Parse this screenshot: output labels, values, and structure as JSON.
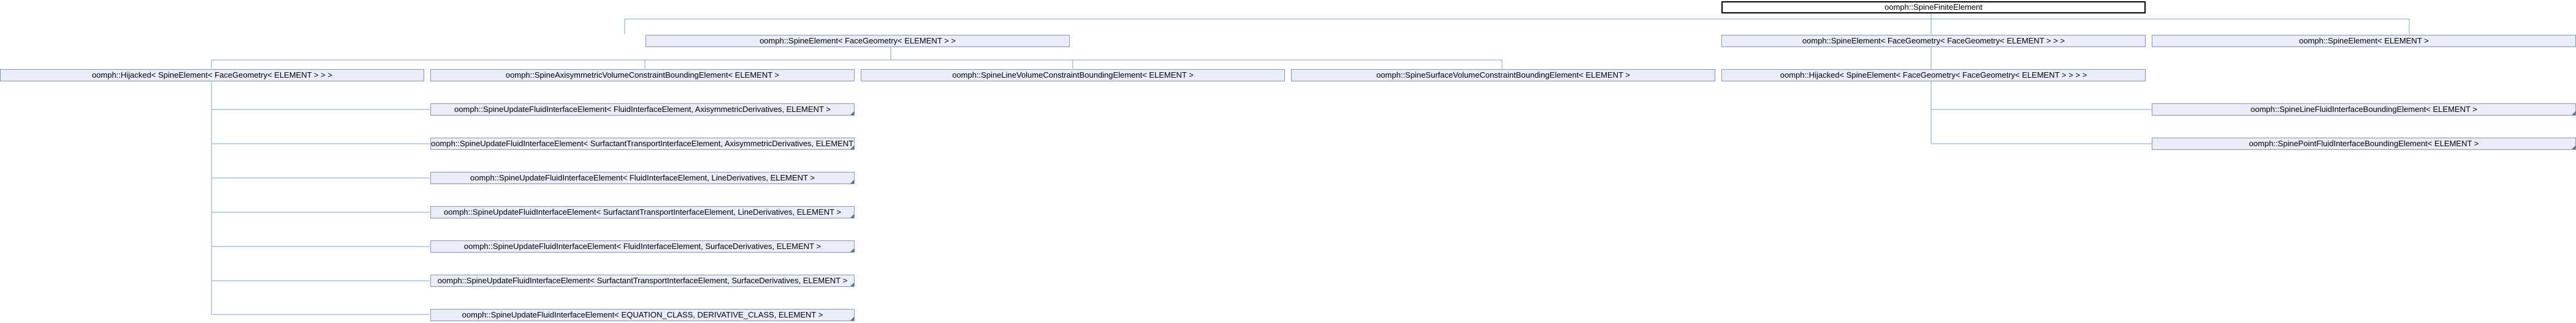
{
  "root": {
    "label": "oomph::SpineFiniteElement"
  },
  "level1": [
    {
      "label": "oomph::SpineElement< FaceGeometry< ELEMENT > >"
    },
    {
      "label": "oomph::SpineElement< FaceGeometry< FaceGeometry< ELEMENT > > >"
    },
    {
      "label": "oomph::SpineElement< ELEMENT >"
    }
  ],
  "level2": [
    {
      "label": "oomph::Hijacked< SpineElement< FaceGeometry< ELEMENT > > >"
    },
    {
      "label": "oomph::SpineAxisymmetricVolumeConstraintBoundingElement< ELEMENT >"
    },
    {
      "label": "oomph::SpineLineVolumeConstraintBoundingElement< ELEMENT >"
    },
    {
      "label": "oomph::SpineSurfaceVolumeConstraintBoundingElement< ELEMENT >"
    },
    {
      "label": "oomph::Hijacked< SpineElement< FaceGeometry< FaceGeometry< ELEMENT > > > >"
    }
  ],
  "update_elements": [
    {
      "label": "oomph::SpineUpdateFluidInterfaceElement< FluidInterfaceElement, AxisymmetricDerivatives, ELEMENT >"
    },
    {
      "label": "oomph::SpineUpdateFluidInterfaceElement< SurfactantTransportInterfaceElement, AxisymmetricDerivatives, ELEMENT >"
    },
    {
      "label": "oomph::SpineUpdateFluidInterfaceElement< FluidInterfaceElement, LineDerivatives, ELEMENT >"
    },
    {
      "label": "oomph::SpineUpdateFluidInterfaceElement< SurfactantTransportInterfaceElement, LineDerivatives, ELEMENT >"
    },
    {
      "label": "oomph::SpineUpdateFluidInterfaceElement< FluidInterfaceElement, SurfaceDerivatives, ELEMENT >"
    },
    {
      "label": "oomph::SpineUpdateFluidInterfaceElement< SurfactantTransportInterfaceElement, SurfaceDerivatives, ELEMENT >"
    },
    {
      "label": "oomph::SpineUpdateFluidInterfaceElement< EQUATION_CLASS, DERIVATIVE_CLASS, ELEMENT >"
    }
  ],
  "bounding_elements": [
    {
      "label": "oomph::SpineLineFluidInterfaceBoundingElement< ELEMENT >"
    },
    {
      "label": "oomph::SpinePointFluidInterfaceBoundingElement< ELEMENT >"
    }
  ],
  "colors": {
    "node_fill": "#e8edf7",
    "node_border": "#8495b8",
    "edge": "#7ea0d6",
    "root_border": "#000000"
  }
}
